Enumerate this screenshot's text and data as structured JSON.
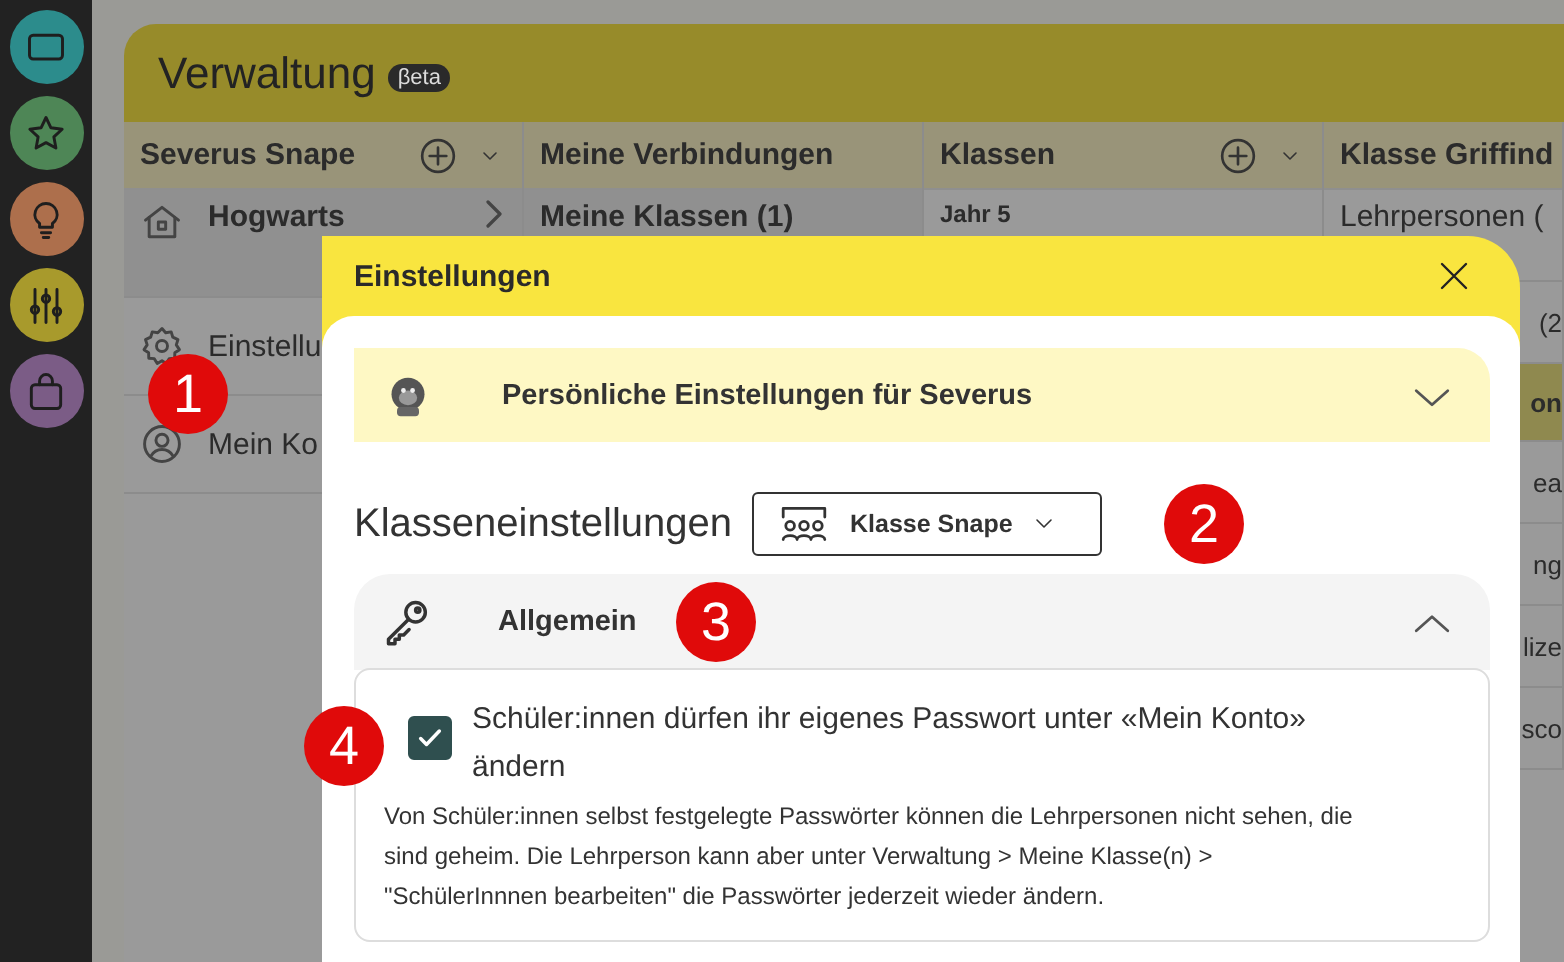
{
  "rail": [
    {
      "color": "#2c8c8c"
    },
    {
      "color": "#4e8656"
    },
    {
      "color": "#ad6f4c"
    },
    {
      "color": "#a89a2c"
    },
    {
      "color": "#7b5c86"
    }
  ],
  "app": {
    "title": "Verwaltung",
    "badge": "βeta",
    "columns": [
      {
        "heading": "Severus Snape",
        "has_add": true,
        "items": [
          {
            "label": "Hogwarts",
            "selected": true,
            "kind": "house"
          },
          {
            "label": "Einstellu",
            "selected": false,
            "kind": "gear"
          },
          {
            "label": "Mein Ko",
            "selected": false,
            "kind": "person"
          }
        ]
      },
      {
        "heading": "Meine Verbindungen",
        "has_add": false,
        "items": [
          {
            "label": "Meine Klassen (1)",
            "selected": true,
            "kind": "plain"
          }
        ]
      },
      {
        "heading": "Klassen",
        "has_add": true,
        "items": [
          {
            "label": "Jahr 5",
            "kind": "group"
          }
        ]
      },
      {
        "heading": "Klasse Griffind",
        "has_add": false,
        "items": [
          {
            "label": "Lehrpersonen (",
            "kind": "plain"
          },
          {
            "label": "(2",
            "kind": "fragment"
          },
          {
            "label": "on",
            "kind": "band"
          },
          {
            "label": "ea",
            "kind": "fragment"
          },
          {
            "label": "ng",
            "kind": "fragment"
          },
          {
            "label": "lize",
            "kind": "fragment"
          },
          {
            "label": "sco",
            "kind": "fragment"
          }
        ]
      }
    ]
  },
  "dialog": {
    "title": "Einstellungen",
    "personal": {
      "label": "Persönliche Einstellungen für Severus",
      "expanded": false
    },
    "class_settings": {
      "heading": "Klasseneinstellungen",
      "class_select": "Klasse Snape"
    },
    "section": {
      "title": "Allgemein",
      "expanded": true,
      "options": [
        {
          "label": "Schüler:innen dürfen ihr eigenes Passwort unter «Mein Konto» ändern",
          "checked": true,
          "description": "Von Schüler:innen selbst festgelegte Passwörter können die Lehrpersonen nicht sehen, die sind geheim. Die Lehrperson kann aber unter Verwaltung > Meine Klasse(n) > \"SchülerInnnen bearbeiten\" die Passwörter jederzeit wieder ändern."
        }
      ]
    }
  },
  "markers": [
    {
      "label": "1"
    },
    {
      "label": "2"
    },
    {
      "label": "3"
    },
    {
      "label": "4"
    }
  ]
}
